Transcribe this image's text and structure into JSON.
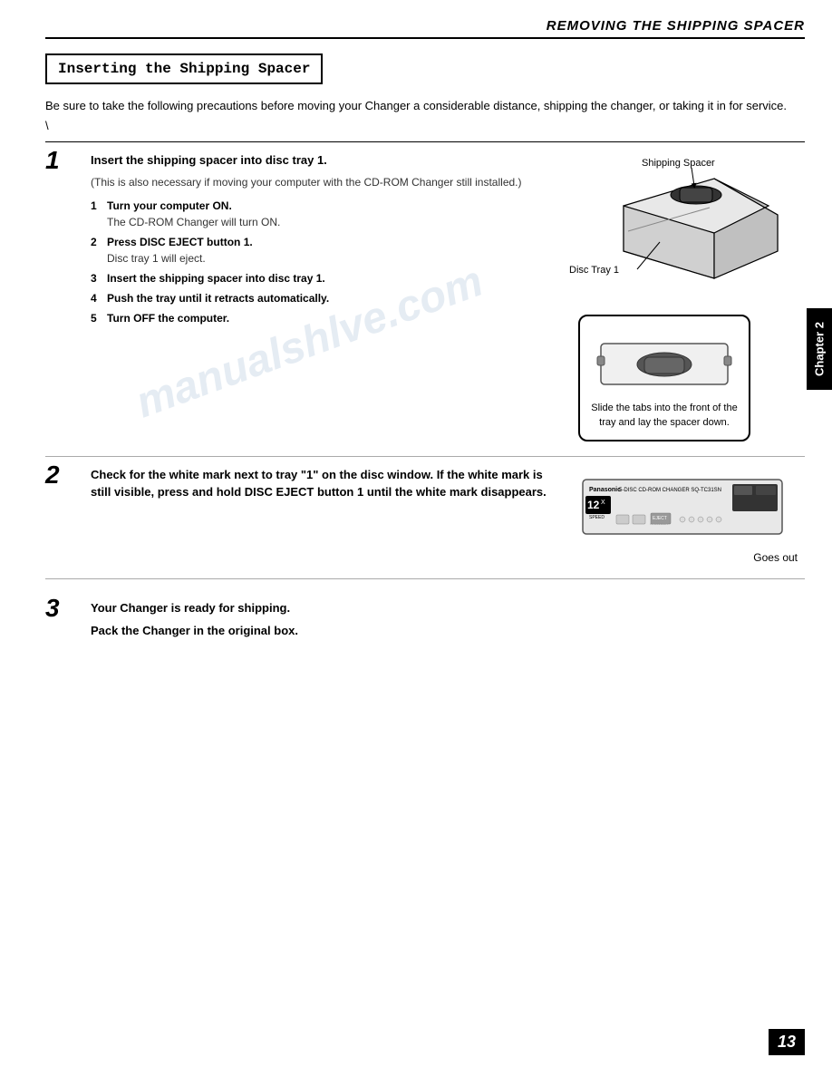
{
  "header": {
    "title": "REMOVING THE SHIPPING SPACER"
  },
  "section": {
    "title": "Inserting the Shipping Spacer"
  },
  "intro": {
    "text": "Be sure to take the following precautions before moving your Changer a considerable distance, shipping the changer, or taking it in for service.",
    "mark": "\\"
  },
  "steps": [
    {
      "number": "1",
      "title": "Insert the shipping spacer into disc tray 1.",
      "desc": "(This is also necessary if moving your computer with the CD-ROM Changer still installed.)",
      "substeps": [
        {
          "num": "1",
          "label": "Turn your computer ON.",
          "text": "The CD-ROM Changer will turn ON."
        },
        {
          "num": "2",
          "label": "Press DISC EJECT button 1.",
          "text": "Disc tray 1 will eject."
        },
        {
          "num": "3",
          "label": "Insert the shipping spacer into disc tray 1.",
          "text": ""
        },
        {
          "num": "4",
          "label": "Push the tray until it retracts automatically.",
          "text": ""
        },
        {
          "num": "5",
          "label": "Turn OFF the computer.",
          "text": ""
        }
      ],
      "image_labels": {
        "shipping_spacer": "Shipping Spacer",
        "disc_tray": "Disc Tray 1",
        "slide_tabs": "Slide the tabs into the front of the tray and lay the spacer down."
      }
    },
    {
      "number": "2",
      "title": "Check for the white mark next to tray \"1\" on the disc window. If the white mark is still visible, press and hold DISC EJECT button 1 until the white mark disappears.",
      "image_labels": {
        "goes_out": "Goes out"
      }
    },
    {
      "number": "3",
      "title": "Your Changer is ready for shipping.",
      "subtitle": "Pack the Changer in the original box."
    }
  ],
  "chapter": {
    "label": "Chapter 2"
  },
  "page_number": "13",
  "watermark": "manualshlve.com"
}
